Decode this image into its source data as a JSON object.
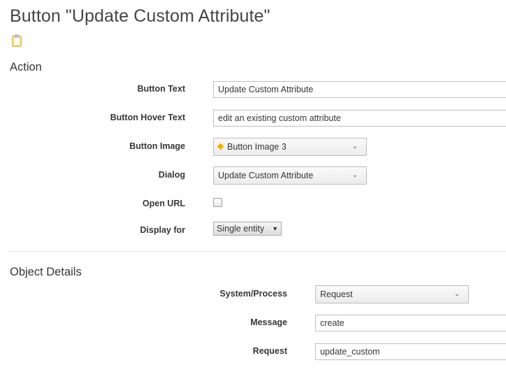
{
  "page": {
    "title": "Button \"Update Custom Attribute\""
  },
  "icons": {
    "clipboard": "clipboard-icon",
    "button_image": "diamond-icon",
    "chevron": "chevron-down-icon"
  },
  "action": {
    "section_title": "Action",
    "button_text_label": "Button Text",
    "button_text_value": "Update Custom Attribute",
    "hover_text_label": "Button Hover Text",
    "hover_text_value": "edit an existing custom attribute",
    "button_image_label": "Button Image",
    "button_image_value": "Button Image 3",
    "dialog_label": "Dialog",
    "dialog_value": "Update Custom Attribute",
    "open_url_label": "Open URL",
    "display_for_label": "Display for",
    "display_for_value": "Single entity"
  },
  "object_details": {
    "section_title": "Object Details",
    "system_process_label": "System/Process",
    "system_process_value": "Request",
    "message_label": "Message",
    "message_value": "create",
    "request_label": "Request",
    "request_value": "update_custom"
  },
  "colors": {
    "accent_diamond": "#f2b300",
    "border": "#bfbfbf"
  }
}
